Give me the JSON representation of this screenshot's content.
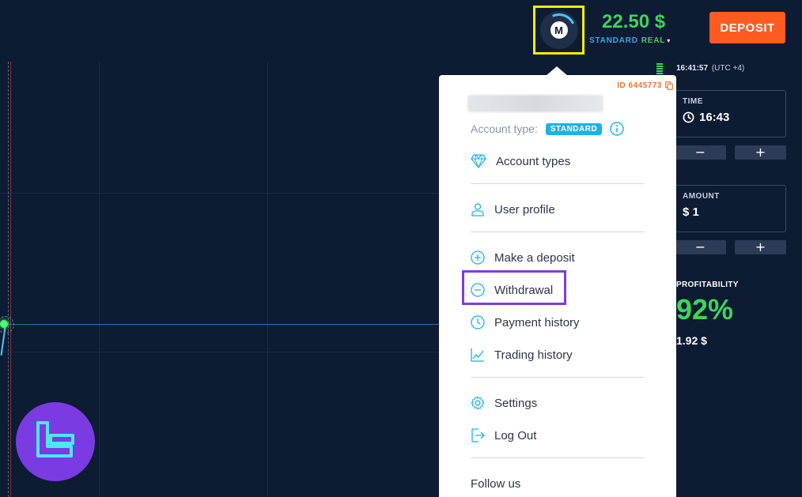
{
  "header": {
    "avatar_letter": "M",
    "balance": "22.50 $",
    "account_mode": "STANDARD",
    "account_kind": "REAL",
    "deposit_label": "DEPOSIT"
  },
  "right_panel": {
    "clock": "16:41:57",
    "timezone": "(UTC +4)",
    "time_label": "TIME",
    "time_value": "16:43",
    "amount_label": "AMOUNT",
    "amount_value": "$ 1",
    "minus": "−",
    "plus": "+",
    "profitability_label": "PROFITABILITY",
    "profitability_value": "92%",
    "profit_amount": "1.92 $"
  },
  "menu": {
    "user_id": "ID 6445773",
    "account_type_label": "Account type:",
    "account_type_value": "STANDARD",
    "items": [
      {
        "label": "Account types",
        "icon": "diamond-icon"
      },
      {
        "label": "User profile",
        "icon": "user-icon"
      },
      {
        "label": "Make a deposit",
        "icon": "plus-circle-icon"
      },
      {
        "label": "Withdrawal",
        "icon": "minus-circle-icon"
      },
      {
        "label": "Payment history",
        "icon": "clock-icon"
      },
      {
        "label": "Trading history",
        "icon": "chart-icon"
      },
      {
        "label": "Settings",
        "icon": "gear-icon"
      },
      {
        "label": "Log Out",
        "icon": "logout-icon"
      }
    ],
    "follow_label": "Follow us"
  },
  "colors": {
    "background": "#0d1b33",
    "accent_green": "#3ed45c",
    "accent_blue": "#19b3e6",
    "deposit_orange": "#ff5a1f",
    "highlight_yellow": "#f5f000",
    "highlight_purple": "#7a3ee0"
  }
}
